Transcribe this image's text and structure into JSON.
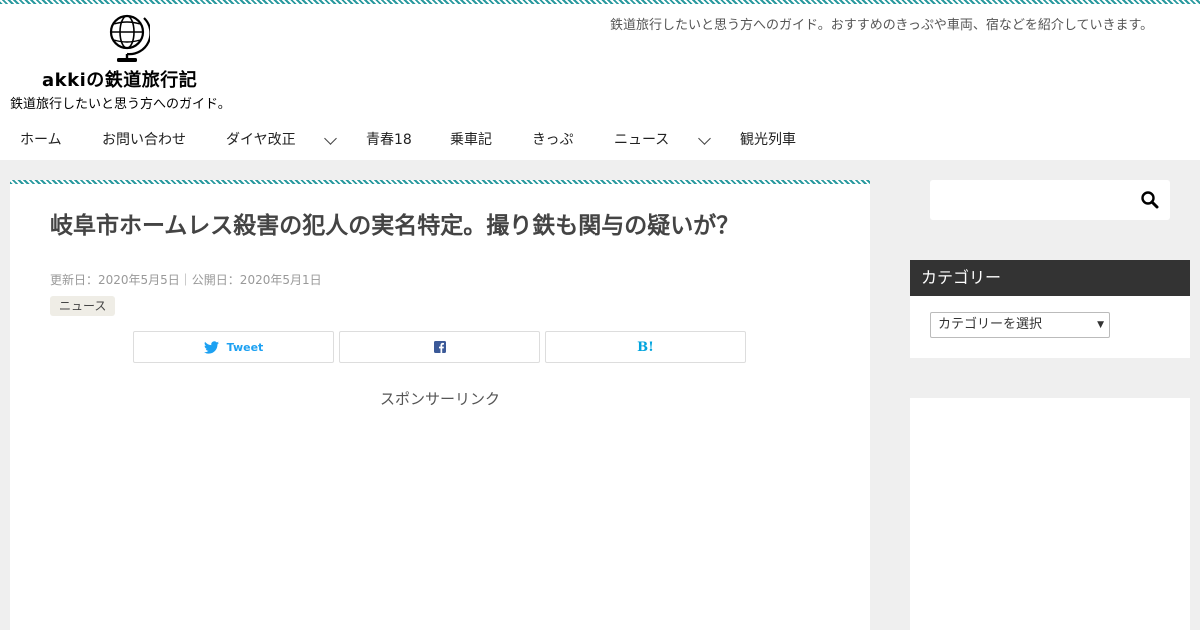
{
  "site": {
    "name": "akkiの鉄道旅行記",
    "tagline": "鉄道旅行したいと思う方へのガイド。",
    "description": "鉄道旅行したいと思う方へのガイド。おすすめのきっぷや車両、宿などを紹介していきます。"
  },
  "nav": {
    "items": [
      {
        "label": "ホーム"
      },
      {
        "label": "お問い合わせ"
      },
      {
        "label": "ダイヤ改正"
      },
      {
        "label": "青春18"
      },
      {
        "label": "乗車記"
      },
      {
        "label": "きっぷ"
      },
      {
        "label": "ニュース"
      },
      {
        "label": "観光列車"
      }
    ]
  },
  "article": {
    "title": "岐阜市ホームレス殺害の犯人の実名特定。撮り鉄も関与の疑いが？",
    "dates": "更新日：2020年5月5日｜公開日：2020年5月1日",
    "category": "ニュース",
    "share": {
      "tweet_label": "Tweet",
      "hatena_label": "B!"
    },
    "sponsor_label": "スポンサーリンク"
  },
  "sidebar": {
    "search": {
      "placeholder": ""
    },
    "category_widget": {
      "title": "カテゴリー",
      "select_value": "カテゴリーを選択"
    }
  },
  "colors": {
    "accent_stripe": "#2a9a9f",
    "widget_header": "#333333",
    "twitter": "#1da1f2",
    "facebook": "#3b5998",
    "hatena": "#00a4de"
  }
}
